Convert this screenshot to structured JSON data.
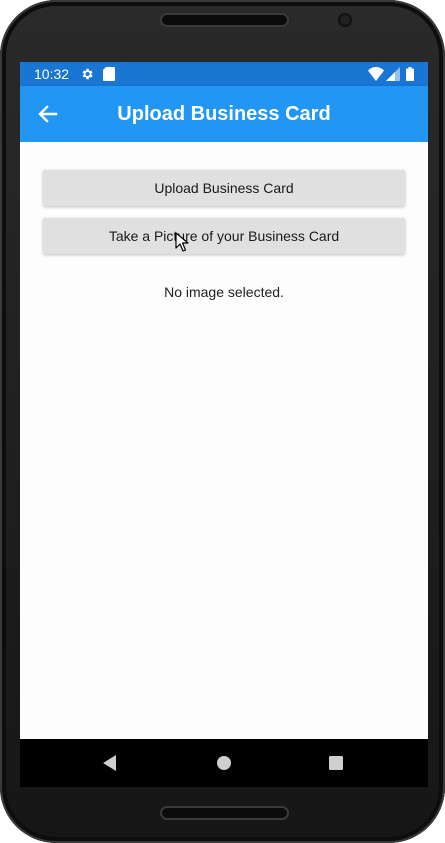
{
  "status_bar": {
    "time": "10:32",
    "left_icons": [
      "gear-icon",
      "sd-card-icon"
    ],
    "right_icons": [
      "wifi-icon",
      "cellular-signal-icon",
      "battery-icon"
    ],
    "background_color": "#1976d2"
  },
  "app_bar": {
    "title": "Upload Business Card",
    "back_icon": "arrow-back-icon",
    "background_color": "#2196f3"
  },
  "main": {
    "buttons": [
      {
        "label": "Upload Business Card"
      },
      {
        "label": "Take a Picture of your Business Card"
      }
    ],
    "status_text": "No image selected."
  },
  "nav_bar": {
    "icons": [
      "nav-back-icon",
      "nav-home-icon",
      "nav-recents-icon"
    ]
  }
}
